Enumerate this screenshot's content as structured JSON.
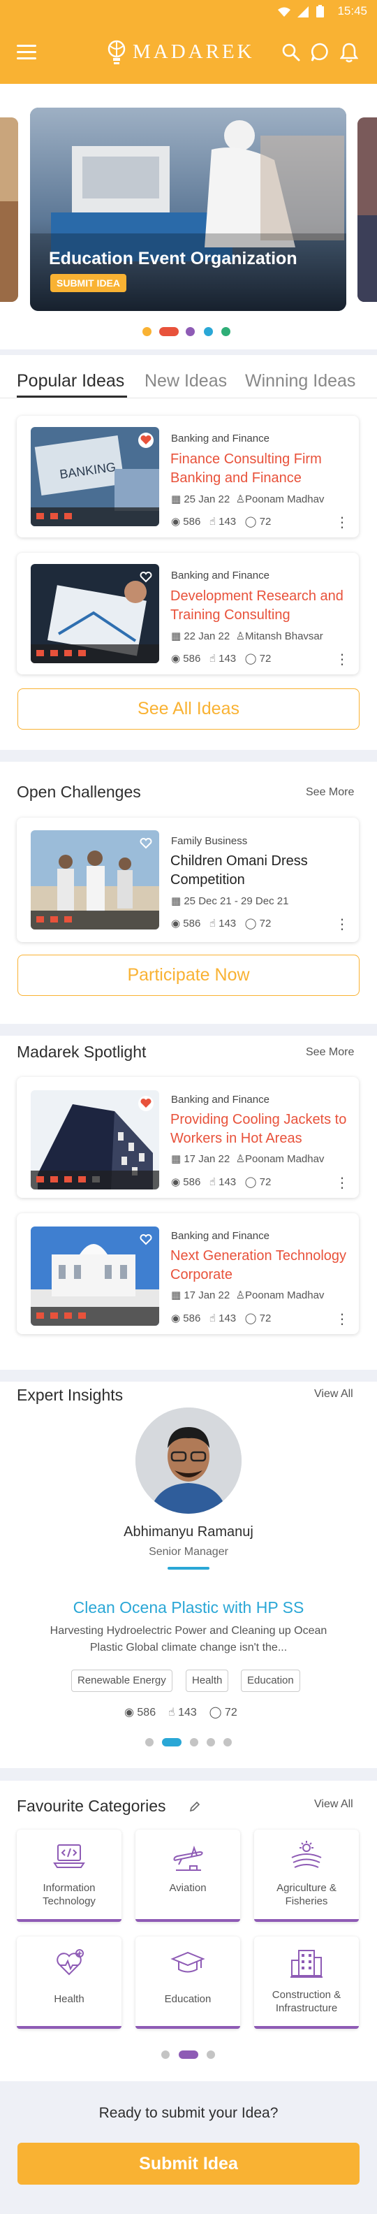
{
  "status": {
    "time": "15:45"
  },
  "header": {
    "logo": "MADAREK"
  },
  "hero": {
    "title": "Education Event Organization",
    "button": "SUBMIT IDEA"
  },
  "tabs": [
    "Popular Ideas",
    "New Ideas",
    "Winning Ideas"
  ],
  "popular_ideas": [
    {
      "category": "Banking and Finance",
      "title": "Finance Consulting Firm Banking and Finance",
      "date": "25 Jan 22",
      "author": "Poonam Madhav",
      "views": "586",
      "likes": "143",
      "comments": "72"
    },
    {
      "category": "Banking and Finance",
      "title": "Development Research and Training Consulting",
      "date": "22 Jan 22",
      "author": "Mitansh Bhavsar",
      "views": "586",
      "likes": "143",
      "comments": "72"
    }
  ],
  "see_all_ideas": "See All Ideas",
  "open_challenges": {
    "title": "Open Challenges",
    "see_more": "See More",
    "item": {
      "category": "Family Business",
      "title": "Children Omani Dress Competition",
      "date": "25 Dec 21 - 29 Dec 21",
      "views": "586",
      "likes": "143",
      "comments": "72"
    },
    "button": "Participate Now"
  },
  "spotlight": {
    "title": "Madarek Spotlight",
    "see_more": "See More",
    "items": [
      {
        "category": "Banking and Finance",
        "title": "Providing Cooling Jackets to Workers in Hot Areas",
        "date": "17 Jan 22",
        "author": "Poonam Madhav",
        "views": "586",
        "likes": "143",
        "comments": "72"
      },
      {
        "category": "Banking and Finance",
        "title": "Next Generation Technology Corporate",
        "date": "17 Jan 22",
        "author": "Poonam Madhav",
        "views": "586",
        "likes": "143",
        "comments": "72"
      }
    ]
  },
  "expert": {
    "title": "Expert Insights",
    "view_all": "View All",
    "name": "Abhimanyu Ramanuj",
    "role": "Senior Manager",
    "headline": "Clean Ocena Plastic with HP SS",
    "summary_line1": "Harvesting Hydroelectric Power and Cleaning up Ocean",
    "summary_line2": "Plastic Global climate change isn't the...",
    "tags": [
      "Renewable Energy",
      "Health",
      "Education"
    ],
    "views": "586",
    "likes": "143",
    "comments": "72"
  },
  "categories": {
    "title": "Favourite Categories",
    "view_all": "View All",
    "items": [
      {
        "line1": "Information",
        "line2": "Technology",
        "icon": "laptop-code-icon"
      },
      {
        "line1": "Aviation",
        "line2": "",
        "icon": "airplane-icon"
      },
      {
        "line1": "Agriculture &",
        "line2": "Fisheries",
        "icon": "agriculture-icon"
      },
      {
        "line1": "Health",
        "line2": "",
        "icon": "health-icon"
      },
      {
        "line1": "Education",
        "line2": "",
        "icon": "graduation-cap-icon"
      },
      {
        "line1": "Construction &",
        "line2": "Infrastructure",
        "icon": "building-icon"
      }
    ]
  },
  "footer": {
    "prompt": "Ready to submit your Idea?",
    "button": "Submit Idea"
  },
  "colors": {
    "brand": "#f9b233",
    "title_red": "#e8523b",
    "expert_blue": "#2aa7d6",
    "category_purple": "#8e5bb5"
  }
}
